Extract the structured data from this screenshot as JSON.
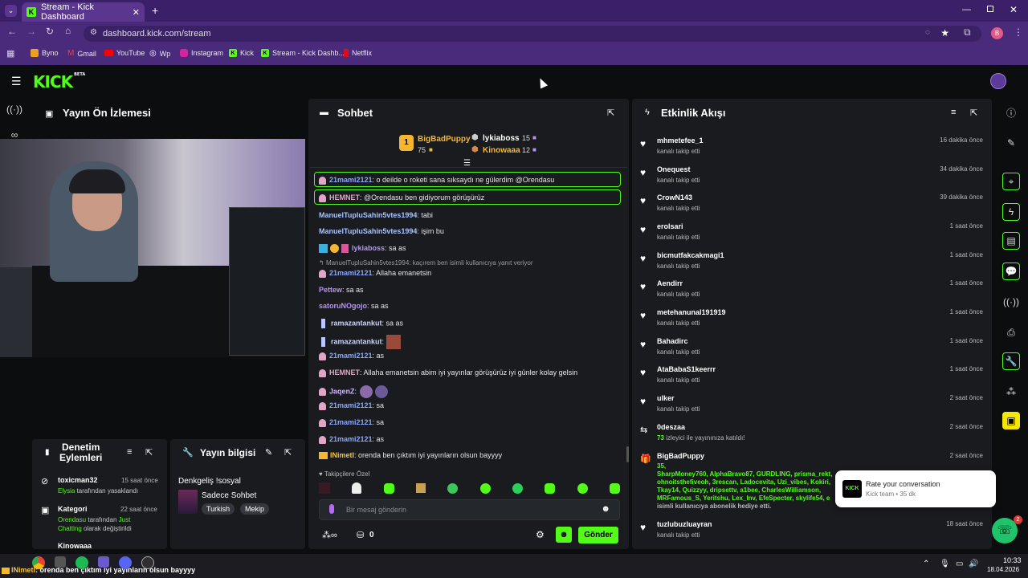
{
  "browser": {
    "tab_title": "Stream - Kick Dashboard",
    "url": "dashboard.kick.com/stream",
    "profile_initial": "B",
    "bookmarks": [
      "Byno",
      "Gmail",
      "YouTube",
      "Wp",
      "Instagram",
      "Kick",
      "Stream - Kick Dashb...",
      "Netflix"
    ]
  },
  "app": {
    "logo": "KICK",
    "logo_beta": "BETA"
  },
  "preview": {
    "title": "Yayın Ön İzlemesi"
  },
  "mod_actions": {
    "title_line1": "Denetim",
    "title_line2": "Eylemleri",
    "items": [
      {
        "user": "toxicman32",
        "time": "15 saat önce",
        "detail_user": "Elysia",
        "detail_text": " tarafından yasaklandı"
      },
      {
        "user": "Kategori",
        "time": "22 saat önce",
        "detail_user": "Orendasu",
        "detail_text": " tarafından ",
        "detail_user2": "Just",
        "detail_line2_user": "Chatting",
        "detail_line2_text": " olarak değiştirildi"
      },
      {
        "user": "Kinowaaa",
        "time": ""
      }
    ]
  },
  "stream_info": {
    "title": "Yayın bilgisi",
    "stream_title": "Denkgeliş !sosyal",
    "category": "Sadece Sohbet",
    "tags": [
      "Turkish",
      "Mekip"
    ]
  },
  "chat": {
    "title": "Sohbet",
    "leaderboard": {
      "first": {
        "rank": "1",
        "name": "BigBadPuppy",
        "value": "75"
      },
      "second": {
        "name": "lykiaboss",
        "value": "15"
      },
      "third": {
        "name": "Kinowaaa",
        "value": "12"
      }
    },
    "messages": [
      {
        "user": "21mami2121",
        "text": ": o deilde o roketi sana sıksaydı ne gülerdim @Orendasu",
        "color": "#8aa6ff"
      },
      {
        "user": "HEMNET",
        "text": ": @Orendasu ben gidiyorum görüşürüz",
        "color": "#e3a4c8"
      },
      {
        "user": "ManuelTupluSahin5vtes1994",
        "text": ": tabi",
        "color": "#a8c4ff"
      },
      {
        "user": "ManuelTupluSahin5vtes1994",
        "text": ": işim bu",
        "color": "#a8c4ff"
      },
      {
        "user": "lykiaboss",
        "text": ": sa as",
        "color": "#b794f6"
      },
      {
        "reply": "ManuelTupluSahin5vtes1994: kaçırem ben isimli kullanıcıya yanıt veriyor"
      },
      {
        "user": "21mami2121",
        "text": ": Allaha emanetsin",
        "color": "#8aa6ff"
      },
      {
        "user": "Pettew",
        "text": ": sa as",
        "color": "#b794f6"
      },
      {
        "user": "satoruNOgojo",
        "text": ": sa as",
        "color": "#b794f6"
      },
      {
        "user": "ramazantankut",
        "text": ": sa as",
        "color": "#cbd5ff"
      },
      {
        "user": "ramazantankut",
        "text": ":",
        "color": "#cbd5ff"
      },
      {
        "user": "21mami2121",
        "text": ": as",
        "color": "#8aa6ff"
      },
      {
        "user": "HEMNET",
        "text": ": Allaha emanetsin abim iyi yayınlar görüşürüz iyi günler kolay gelsin",
        "color": "#e3a4c8"
      },
      {
        "user": "JaqenZ",
        "text": ":",
        "color": "#d2b4ff"
      },
      {
        "user": "21mami2121",
        "text": ": sa",
        "color": "#8aa6ff"
      },
      {
        "user": "21mami2121",
        "text": ": sa",
        "color": "#8aa6ff"
      },
      {
        "user": "21mami2121",
        "text": ": as",
        "color": "#8aa6ff"
      },
      {
        "user": "lNimetl",
        "text": ": orenda ben çıktım iyi yayınların olsun bayyyy",
        "color": "#f6c343"
      }
    ],
    "emote_section": "Takipçilere Özel",
    "input_placeholder": "Bir mesaj gönderin",
    "points": "0",
    "send_label": "Gönder"
  },
  "activity": {
    "title": "Etkinlik Akışı",
    "items": [
      {
        "name": "mhmetefee_1",
        "sub": "kanalı takip etti",
        "time": "16 dakika önce"
      },
      {
        "name": "Onequest",
        "sub": "kanalı takip etti",
        "time": "34 dakika önce"
      },
      {
        "name": "CrowN143",
        "sub": "kanalı takip etti",
        "time": "39 dakika önce"
      },
      {
        "name": "erolsari",
        "sub": "kanalı takip etti",
        "time": "1 saat önce"
      },
      {
        "name": "bicmutfakcakmagi1",
        "sub": "kanalı takip etti",
        "time": "1 saat önce"
      },
      {
        "name": "Aendirr",
        "sub": "kanalı takip etti",
        "time": "1 saat önce"
      },
      {
        "name": "metehanunal191919",
        "sub": "kanalı takip etti",
        "time": "1 saat önce"
      },
      {
        "name": "Bahadirc",
        "sub": "kanalı takip etti",
        "time": "1 saat önce"
      },
      {
        "name": "AtaBabaS1keerrr",
        "sub": "kanalı takip etti",
        "time": "1 saat önce"
      },
      {
        "name": "ulker",
        "sub": "kanalı takip etti",
        "time": "2 saat önce"
      }
    ],
    "host": {
      "name": "0deszaa",
      "count": "73",
      "text": " izleyici ile yayınınıza katıldı!",
      "time": "2 saat önce"
    },
    "gift": {
      "name": "BigBadPuppy",
      "time": "2 saat önce",
      "count": "35,",
      "line1": "SharpMoney760, AlphaBravo87, GURDLING, prisma_rekt,",
      "line2": "ohnoitsthefiveoh, 3rescan, Ladocevita, Uzi_vibes, Kokiri,",
      "line3": "Tkay14, Quizzyy, dripsettv, a1bee, CharlesWilliamson,",
      "line4": "MRFamous_S, Yeritshu, Lex_Inv, EfeSpecter, skylife54, e",
      "line5": "isimli kullanıcıya abonelik hediye etti."
    },
    "last": {
      "name": "tuzlubuzluayran",
      "sub": "kanalı takip etti",
      "time": "18 saat önce"
    }
  },
  "toast": {
    "title": "Rate your conversation",
    "sub": "Kick team • 35 dk"
  },
  "support_badge": "2",
  "taskbar": {
    "overlay_user": "lNimetl",
    "overlay_text": ": orenda ben çıktım iyi yayınların olsun bayyyy",
    "time": "10:33",
    "date": "18.04.2026"
  }
}
